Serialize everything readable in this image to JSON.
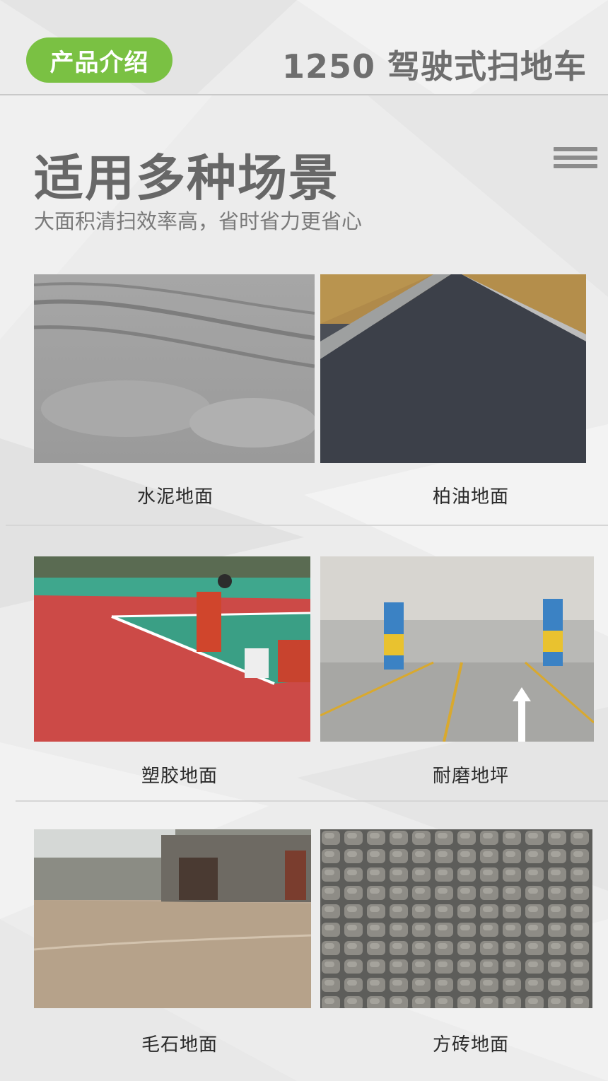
{
  "header": {
    "badge_label": "产品介绍",
    "product_title": "1250 驾驶式扫地车"
  },
  "section": {
    "title": "适用多种场景",
    "subtitle": "大面积清扫效率高，省时省力更省心"
  },
  "scenes": [
    {
      "label": "水泥地面",
      "icon": "cement-floor-photo"
    },
    {
      "label": "柏油地面",
      "icon": "asphalt-road-photo"
    },
    {
      "label": "塑胶地面",
      "icon": "rubber-court-photo"
    },
    {
      "label": "耐磨地坪",
      "icon": "parking-garage-photo"
    },
    {
      "label": "毛石地面",
      "icon": "rubble-stone-photo"
    },
    {
      "label": "方砖地面",
      "icon": "paving-tile-photo"
    }
  ],
  "colors": {
    "accent": "#7ac143",
    "title_gray": "#676767"
  }
}
